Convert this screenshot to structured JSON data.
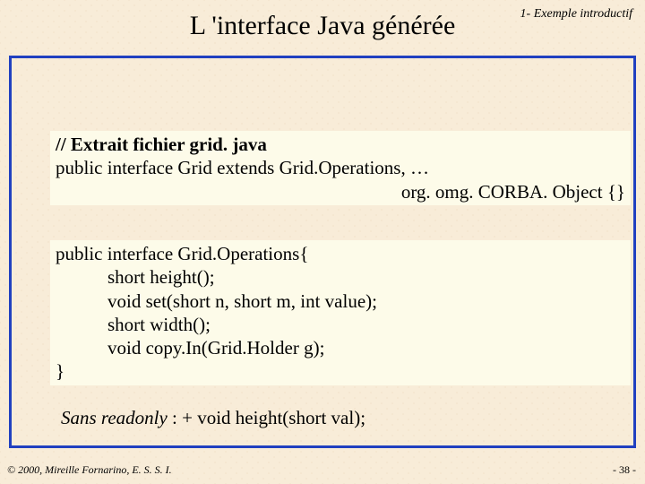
{
  "header_tag": "1- Exemple introductif",
  "title": "L 'interface Java générée",
  "code1": {
    "line1": "// Extrait fichier grid. java",
    "line2": "public interface Grid extends Grid.Operations, …",
    "line3": "org. omg. CORBA. Object {}"
  },
  "code2": {
    "line1": "public interface Grid.Operations{",
    "line2": "short height();",
    "line3": "void set(short n, short m, int value);",
    "line4": "short width();",
    "line5": "void copy.In(Grid.Holder g);",
    "line6": "}"
  },
  "note": {
    "italic": "Sans readonly",
    "rest": " : +  void height(short val);"
  },
  "copyright": "© 2000, Mireille Fornarino, E. S. S. I.",
  "pagenum": "- 38 -"
}
